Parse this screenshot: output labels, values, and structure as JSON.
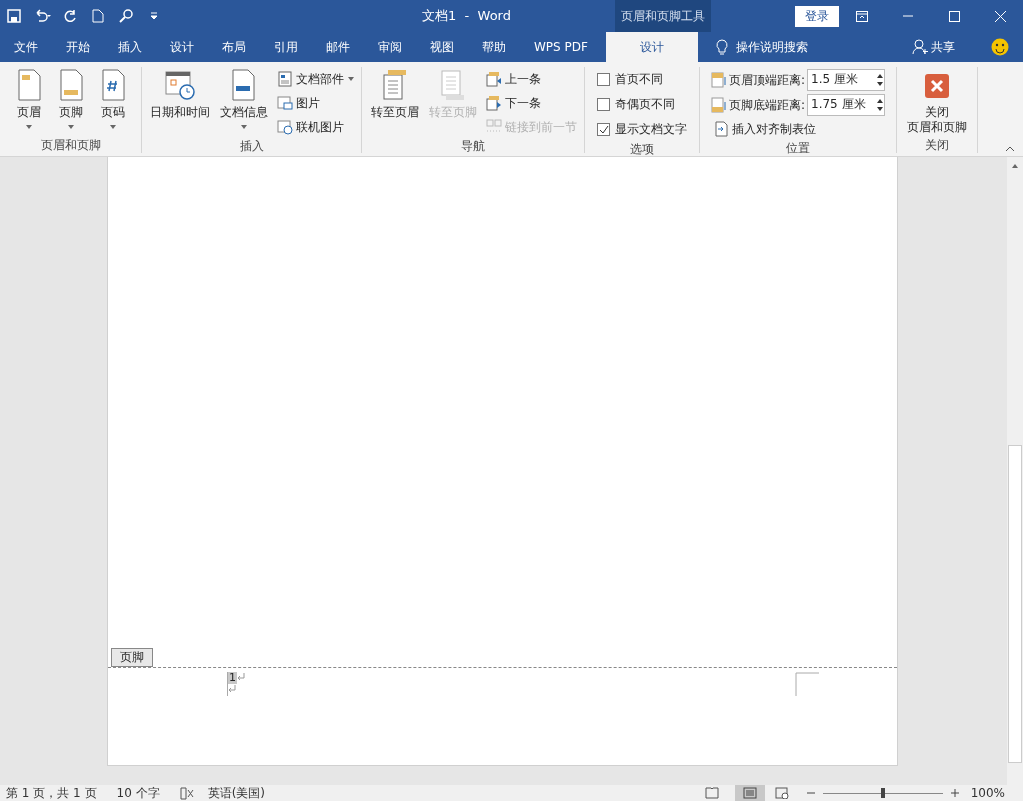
{
  "window": {
    "title": "文档1  -  Word",
    "contextual_tab": "页眉和页脚工具",
    "login": "登录"
  },
  "tabs": [
    {
      "label": "文件",
      "selected": false
    },
    {
      "label": "开始",
      "selected": false
    },
    {
      "label": "插入",
      "selected": false
    },
    {
      "label": "设计",
      "selected": false
    },
    {
      "label": "布局",
      "selected": false
    },
    {
      "label": "引用",
      "selected": false
    },
    {
      "label": "邮件",
      "selected": false
    },
    {
      "label": "审阅",
      "selected": false
    },
    {
      "label": "视图",
      "selected": false
    },
    {
      "label": "帮助",
      "selected": false
    },
    {
      "label": "WPS PDF",
      "selected": false
    },
    {
      "label": "设计",
      "selected": true
    }
  ],
  "tell_me": "操作说明搜索",
  "share": "共享",
  "ribbon": [
    {
      "label": "页眉和页脚",
      "items": [
        {
          "kind": "large",
          "label": "页眉",
          "dropdown": true,
          "disabled": false
        },
        {
          "kind": "large",
          "label": "页脚",
          "dropdown": true,
          "disabled": false
        },
        {
          "kind": "large",
          "label": "页码",
          "dropdown": true,
          "disabled": false
        }
      ]
    },
    {
      "label": "插入",
      "items": [
        {
          "kind": "large",
          "label": "日期和时间",
          "dropdown": false,
          "disabled": false
        },
        {
          "kind": "large",
          "label": "文档信息",
          "dropdown": true,
          "disabled": false
        },
        {
          "kind": "small",
          "label": "文档部件",
          "dropdown": true,
          "disabled": false
        },
        {
          "kind": "small",
          "label": "图片",
          "dropdown": false,
          "disabled": false
        },
        {
          "kind": "small",
          "label": "联机图片",
          "dropdown": false,
          "disabled": false
        }
      ]
    },
    {
      "label": "导航",
      "items": [
        {
          "kind": "large",
          "label": "转至页眉",
          "dropdown": false,
          "disabled": false
        },
        {
          "kind": "large",
          "label": "转至页脚",
          "dropdown": false,
          "disabled": true
        },
        {
          "kind": "small",
          "label": "上一条",
          "dropdown": false,
          "disabled": false
        },
        {
          "kind": "small",
          "label": "下一条",
          "dropdown": false,
          "disabled": false
        },
        {
          "kind": "small",
          "label": "链接到前一节",
          "dropdown": false,
          "disabled": true
        }
      ]
    },
    {
      "label": "选项",
      "items": [
        {
          "kind": "checkbox",
          "label": "首页不同",
          "checked": false
        },
        {
          "kind": "checkbox",
          "label": "奇偶页不同",
          "checked": false
        },
        {
          "kind": "checkbox",
          "label": "显示文档文字",
          "checked": true
        }
      ]
    },
    {
      "label": "位置",
      "items": [
        {
          "kind": "spinner",
          "label": "页眉顶端距离:",
          "value": "1.5 厘米"
        },
        {
          "kind": "spinner",
          "label": "页脚底端距离:",
          "value": "1.75 厘米"
        },
        {
          "kind": "small",
          "label": "插入对齐制表位",
          "dropdown": false,
          "disabled": false
        }
      ]
    },
    {
      "label": "关闭",
      "items": [
        {
          "kind": "close",
          "lines": [
            "关闭",
            "页眉和页脚"
          ]
        }
      ]
    }
  ],
  "document": {
    "footer_tag": "页脚",
    "page_number": "1"
  },
  "status_bar": {
    "page": "第 1 页，共 1 页",
    "words": "10 个字",
    "language": "英语(美国)",
    "zoom": "100%",
    "zoom_slider": {
      "level": 0.5
    }
  }
}
